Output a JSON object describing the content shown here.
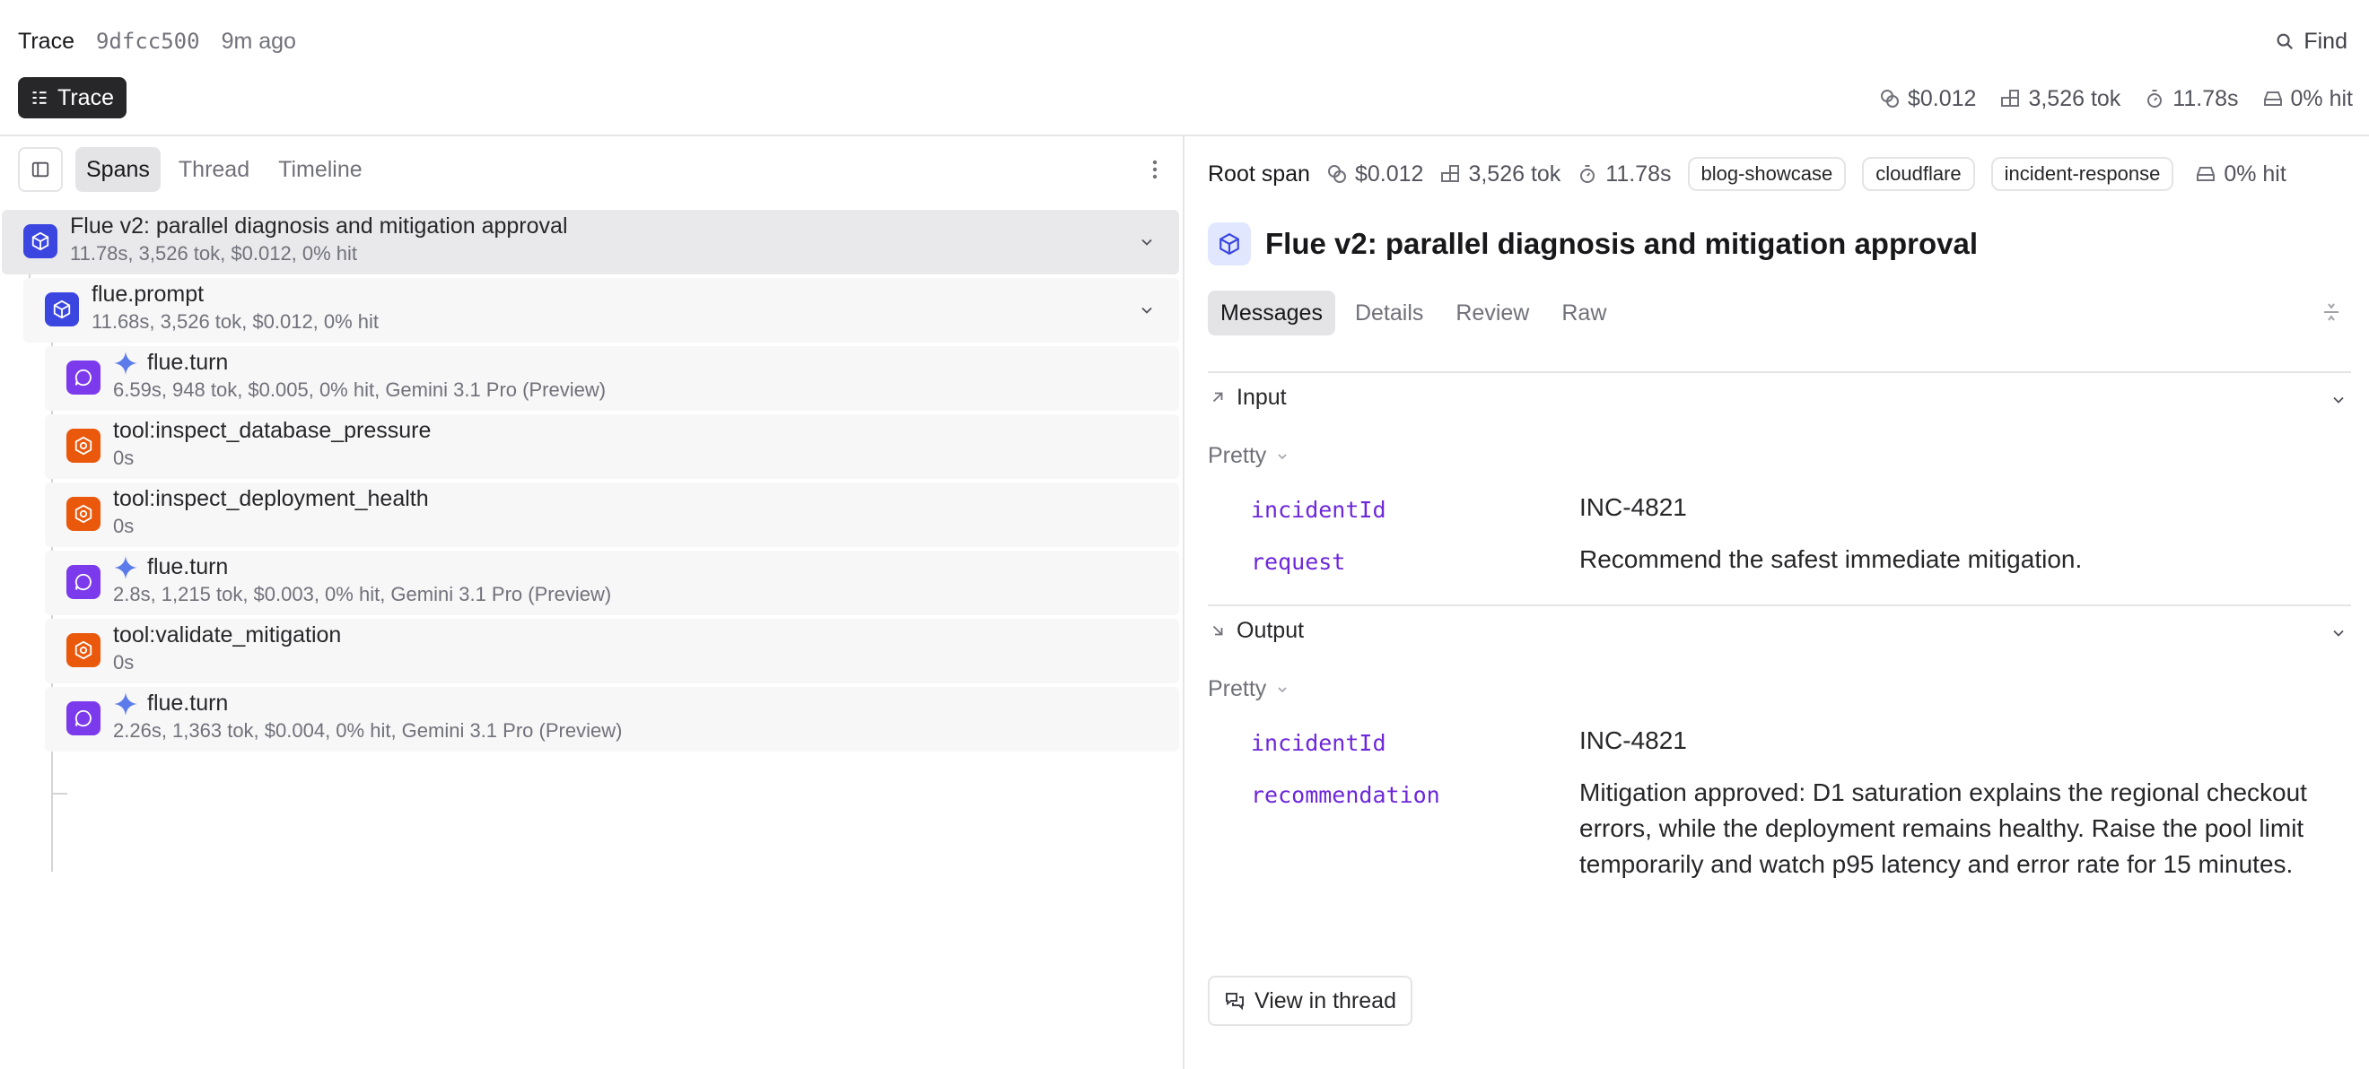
{
  "header": {
    "crumb": "Trace",
    "trace_id": "9dfcc500",
    "age": "9m ago",
    "find_label": "Find",
    "view_button": "Trace",
    "stats": {
      "cost": "$0.012",
      "tokens": "3,526 tok",
      "duration": "11.78s",
      "cache": "0% hit"
    }
  },
  "left": {
    "tabs": [
      "Spans",
      "Thread",
      "Timeline"
    ],
    "active_tab": "Spans",
    "spans": [
      {
        "name": "Flue v2: parallel diagnosis and mitigation approval",
        "meta": "11.78s, 3,526 tok, $0.012, 0% hit",
        "kind": "root"
      },
      {
        "name": "flue.prompt",
        "meta": "11.68s, 3,526 tok, $0.012, 0% hit",
        "kind": "prompt"
      },
      {
        "name": "flue.turn",
        "meta": "6.59s, 948 tok, $0.005, 0% hit, Gemini 3.1 Pro (Preview)",
        "kind": "turn"
      },
      {
        "name": "tool:inspect_database_pressure",
        "meta": "0s",
        "kind": "tool"
      },
      {
        "name": "tool:inspect_deployment_health",
        "meta": "0s",
        "kind": "tool"
      },
      {
        "name": "flue.turn",
        "meta": "2.8s, 1,215 tok, $0.003, 0% hit, Gemini 3.1 Pro (Preview)",
        "kind": "turn"
      },
      {
        "name": "tool:validate_mitigation",
        "meta": "0s",
        "kind": "tool"
      },
      {
        "name": "flue.turn",
        "meta": "2.26s, 1,363 tok, $0.004, 0% hit, Gemini 3.1 Pro (Preview)",
        "kind": "turn"
      }
    ]
  },
  "right": {
    "span_label": "Root span",
    "cost": "$0.012",
    "tokens": "3,526 tok",
    "duration": "11.78s",
    "tags": [
      "blog-showcase",
      "cloudflare",
      "incident-response"
    ],
    "cache": "0% hit",
    "title": "Flue v2: parallel diagnosis and mitigation approval",
    "tabs": [
      "Messages",
      "Details",
      "Review",
      "Raw"
    ],
    "active_tab": "Messages",
    "input": {
      "label": "Input",
      "format": "Pretty",
      "fields": [
        {
          "key": "incidentId",
          "value": "INC-4821"
        },
        {
          "key": "request",
          "value": "Recommend the safest immediate mitigation."
        }
      ]
    },
    "output": {
      "label": "Output",
      "format": "Pretty",
      "fields": [
        {
          "key": "incidentId",
          "value": "INC-4821"
        },
        {
          "key": "recommendation",
          "value": "Mitigation approved: D1 saturation explains the regional checkout errors, while the deployment remains healthy. Raise the pool limit temporarily and watch p95 latency and error rate for 15 minutes."
        }
      ]
    },
    "view_in_thread": "View in thread"
  },
  "colors": {
    "root_chip": "#3b46e0",
    "turn_chip": "#7c3aed",
    "tool_chip": "#ea580c",
    "key_text": "#6d28d9",
    "gemini_star": "#5b7bea"
  }
}
